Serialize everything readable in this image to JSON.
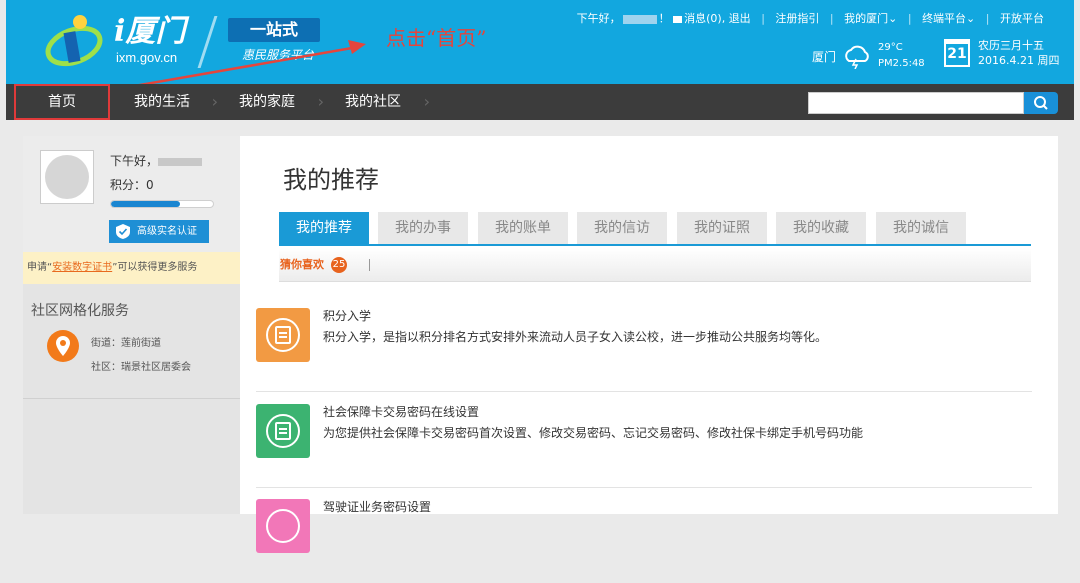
{
  "header": {
    "logo_text": "i厦门",
    "logo_domain": "ixm.gov.cn",
    "brand_tag": "一站式",
    "brand_sub": "惠民服务平台",
    "annotation": "点击“首页”",
    "greeting_prefix": "下午好，",
    "greeting_suffix": "！",
    "messages": "消息(0),",
    "logout": "退出",
    "links": [
      "注册指引",
      "我的厦门⌄",
      "终端平台⌄",
      "开放平台"
    ],
    "city": "厦门",
    "temperature": "29°C",
    "pm": "PM2.5:48",
    "calendar_day": "21",
    "lunar_date": "农历三月十五",
    "date": "2016.4.21 周四",
    "accent": "#12a7df"
  },
  "nav": {
    "items": [
      "首页",
      "我的生活",
      "我的家庭",
      "我的社区"
    ],
    "search_placeholder": ""
  },
  "sidebar": {
    "greeting": "下午好，",
    "points": "积分：0",
    "progress_fraction": 0.68,
    "verify_label": "高级实名认证",
    "notice_prefix": "申请“",
    "notice_link": "安装数字证书",
    "notice_suffix": "”可以获得更多服务",
    "grid_title": "社区网格化服务",
    "street": "街道：莲前街道",
    "community": "社区：瑞景社区居委会"
  },
  "main": {
    "title": "我的推荐",
    "tabs": [
      "我的推荐",
      "我的办事",
      "我的账单",
      "我的信访",
      "我的证照",
      "我的收藏",
      "我的诚信"
    ],
    "guess_label": "猜你喜欢",
    "guess_count": "25",
    "items": [
      {
        "title": "积分入学",
        "desc": "积分入学，是指以积分排名方式安排外来流动人员子女入读公校，进一步推动公共服务均等化。",
        "color": "#f29a43"
      },
      {
        "title": "社会保障卡交易密码在线设置",
        "desc": "为您提供社会保障卡交易密码首次设置、修改交易密码、忘记交易密码、修改社保卡绑定手机号码功能",
        "color": "#3cb371"
      },
      {
        "title": "驾驶证业务密码设置",
        "desc": "",
        "color": "#f277b8"
      }
    ]
  }
}
